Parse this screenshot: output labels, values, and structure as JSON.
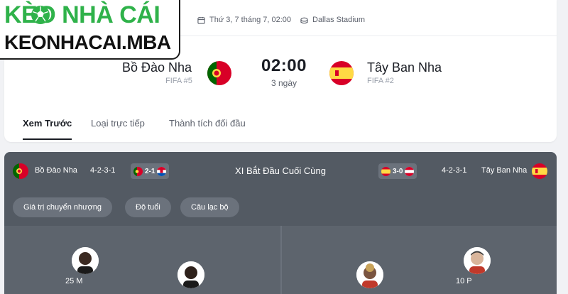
{
  "watermark": {
    "line1_pre": "K",
    "line1_post": "",
    "line1": "KÈO NHÀ CÁI",
    "line2": "KEONHACAI.MBA"
  },
  "match": {
    "datetime": "Thứ 3, 7 tháng 7, 02:00",
    "venue": "Dallas Stadium",
    "home": {
      "name": "Bồ Đào Nha",
      "rank": "FIFA #5"
    },
    "away": {
      "name": "Tây Ban Nha",
      "rank": "FIFA #2"
    },
    "time": "02:00",
    "countdown": "3 ngày"
  },
  "tabs": [
    {
      "label": "Xem Trước",
      "active": true
    },
    {
      "label": "Loại trực tiếp",
      "active": false
    },
    {
      "label": "Thành tích đối đầu",
      "active": false
    }
  ],
  "lineup": {
    "title": "XI Bắt Đầu Cuối Cùng",
    "home": {
      "name": "Bồ Đào Nha",
      "formation": "4-2-3-1",
      "last_result": "2-1"
    },
    "away": {
      "name": "Tây Ban Nha",
      "formation": "4-2-3-1",
      "last_result": "3-0"
    },
    "filters": [
      "Giá trị chuyển nhượng",
      "Độ tuổi",
      "Câu lạc bộ"
    ],
    "players": [
      {
        "label": "25 M",
        "side": "home"
      },
      {
        "label": "",
        "side": "home"
      },
      {
        "label": "",
        "side": "away"
      },
      {
        "label": "10 P",
        "side": "away"
      }
    ]
  },
  "colors": {
    "brand_green": "#2fb24a",
    "lineup_bg": "#535a63",
    "pill_bg": "#6b727c"
  },
  "icons": [
    "calendar-icon",
    "stadium-icon",
    "portugal-flag-icon",
    "spain-flag-icon",
    "croatia-flag-icon",
    "austria-flag-icon",
    "soccer-ball-icon"
  ]
}
